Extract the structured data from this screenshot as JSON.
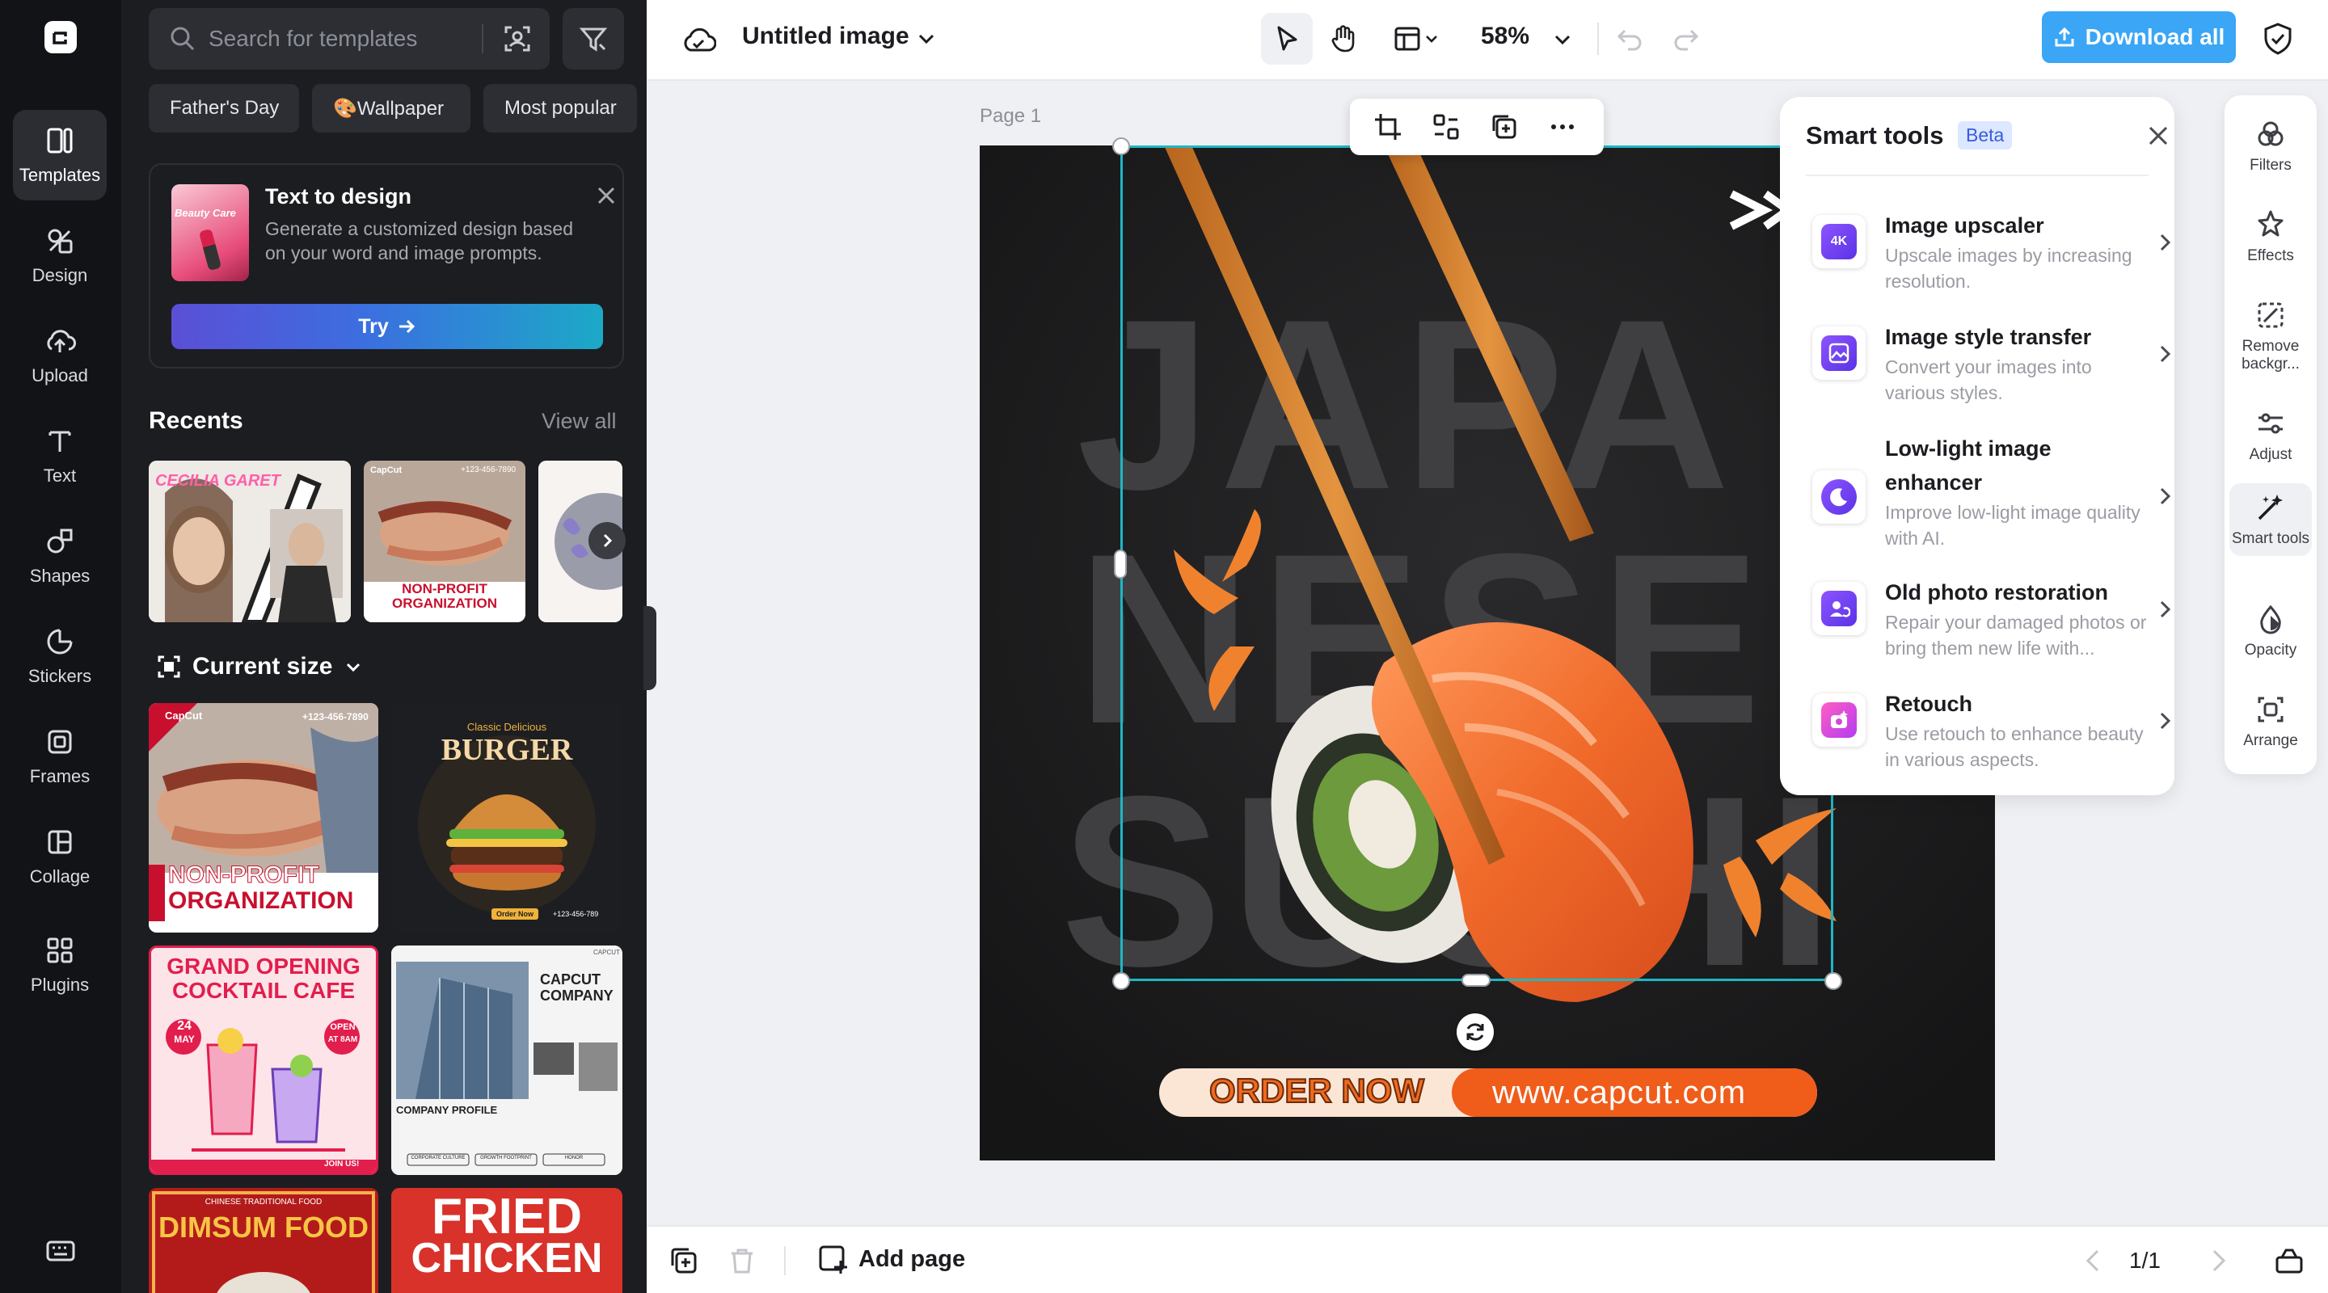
{
  "rail": {
    "items": [
      {
        "label": "Templates",
        "icon": "templates-icon"
      },
      {
        "label": "Design",
        "icon": "design-icon"
      },
      {
        "label": "Upload",
        "icon": "upload-icon"
      },
      {
        "label": "Text",
        "icon": "text-icon"
      },
      {
        "label": "Shapes",
        "icon": "shapes-icon"
      },
      {
        "label": "Stickers",
        "icon": "stickers-icon"
      },
      {
        "label": "Frames",
        "icon": "frames-icon"
      },
      {
        "label": "Collage",
        "icon": "collage-icon"
      },
      {
        "label": "Plugins",
        "icon": "plugins-icon"
      }
    ]
  },
  "panel": {
    "search_placeholder": "Search for templates",
    "chips": [
      "Father's Day",
      "🎨Wallpaper",
      "Most popular"
    ],
    "text_to_design": {
      "thumb_text": "Beauty Care",
      "title": "Text to design",
      "description": "Generate a customized design based on your word and image prompts.",
      "try_label": "Try"
    },
    "recents_title": "Recents",
    "view_all": "View all",
    "recent_items": [
      {
        "title": "CECILIA GARET"
      },
      {
        "title": "NON-PROFIT ORGANIZATION",
        "brand": "CapCut",
        "phone": "+123-456-7890"
      }
    ],
    "current_size": "Current size",
    "templates": {
      "nonprofit": {
        "brand": "CapCut",
        "phone": "+123-456-7890",
        "line1": "NON-PROFIT",
        "line2": "ORGANIZATION"
      },
      "burger": {
        "small": "Classic Delicious",
        "title": "BURGER",
        "button": "Order Now",
        "phone": "+123-456-789"
      },
      "cocktail": {
        "line1": "GRAND OPENING",
        "line2": "COCKTAIL CAFE",
        "date_num": "24",
        "date_month": "MAY",
        "open1": "OPEN",
        "open2": "AT 8AM",
        "join": "JOIN US!"
      },
      "company": {
        "tag": "CAPCUT",
        "line1": "CAPCUT",
        "line2": "COMPANY",
        "profile": "COMPANY PROFILE",
        "btn1": "CORPORATE CULTURE",
        "btn2": "GROWTH FOOTPRINT",
        "btn3": "HONOR"
      },
      "dimsum": {
        "small": "CHINESE TRADITIONAL FOOD",
        "title": "DIMSUM FOOD"
      },
      "fried": {
        "line1": "FRIED",
        "line2": "CHICKEN"
      }
    }
  },
  "topbar": {
    "doc_title": "Untitled image",
    "zoom": "58%",
    "download_label": "Download all"
  },
  "canvas": {
    "page_label": "Page 1",
    "bg_words": [
      "JAPA",
      "NESE",
      "SUSHI"
    ],
    "order_label": "ORDER NOW",
    "url": "www.capcut.com"
  },
  "smart_tools": {
    "title": "Smart tools",
    "beta": "Beta",
    "tools": [
      {
        "name": "Image upscaler",
        "desc": "Upscale images by increasing resolution.",
        "icon": "upscaler-icon",
        "badge": "4K"
      },
      {
        "name": "Image style transfer",
        "desc": "Convert your images into various styles.",
        "icon": "style-transfer-icon"
      },
      {
        "name": "Low-light image enhancer",
        "desc": "Improve low-light image quality with AI.",
        "icon": "low-light-icon"
      },
      {
        "name": "Old photo restoration",
        "desc": "Repair your damaged photos or bring them new life with...",
        "icon": "restoration-icon"
      },
      {
        "name": "Retouch",
        "desc": "Use retouch to enhance beauty in various aspects.",
        "icon": "retouch-icon"
      }
    ]
  },
  "right_tools": [
    {
      "label": "Filters",
      "icon": "filters-icon"
    },
    {
      "label": "Effects",
      "icon": "effects-icon"
    },
    {
      "label": "Remove backgr...",
      "icon": "remove-background-icon"
    },
    {
      "label": "Adjust",
      "icon": "adjust-icon"
    },
    {
      "label": "Smart tools",
      "icon": "smart-tools-icon"
    },
    {
      "label": "Opacity",
      "icon": "opacity-icon"
    },
    {
      "label": "Arrange",
      "icon": "arrange-icon"
    }
  ],
  "bottombar": {
    "add_page": "Add page",
    "pager": "1/1"
  },
  "colors": {
    "accent": "#3aa6f5",
    "selection": "#1fb6c4",
    "dark_panel": "#1c1d21",
    "rail": "#121316",
    "sushi_orange": "#f08a3a"
  }
}
